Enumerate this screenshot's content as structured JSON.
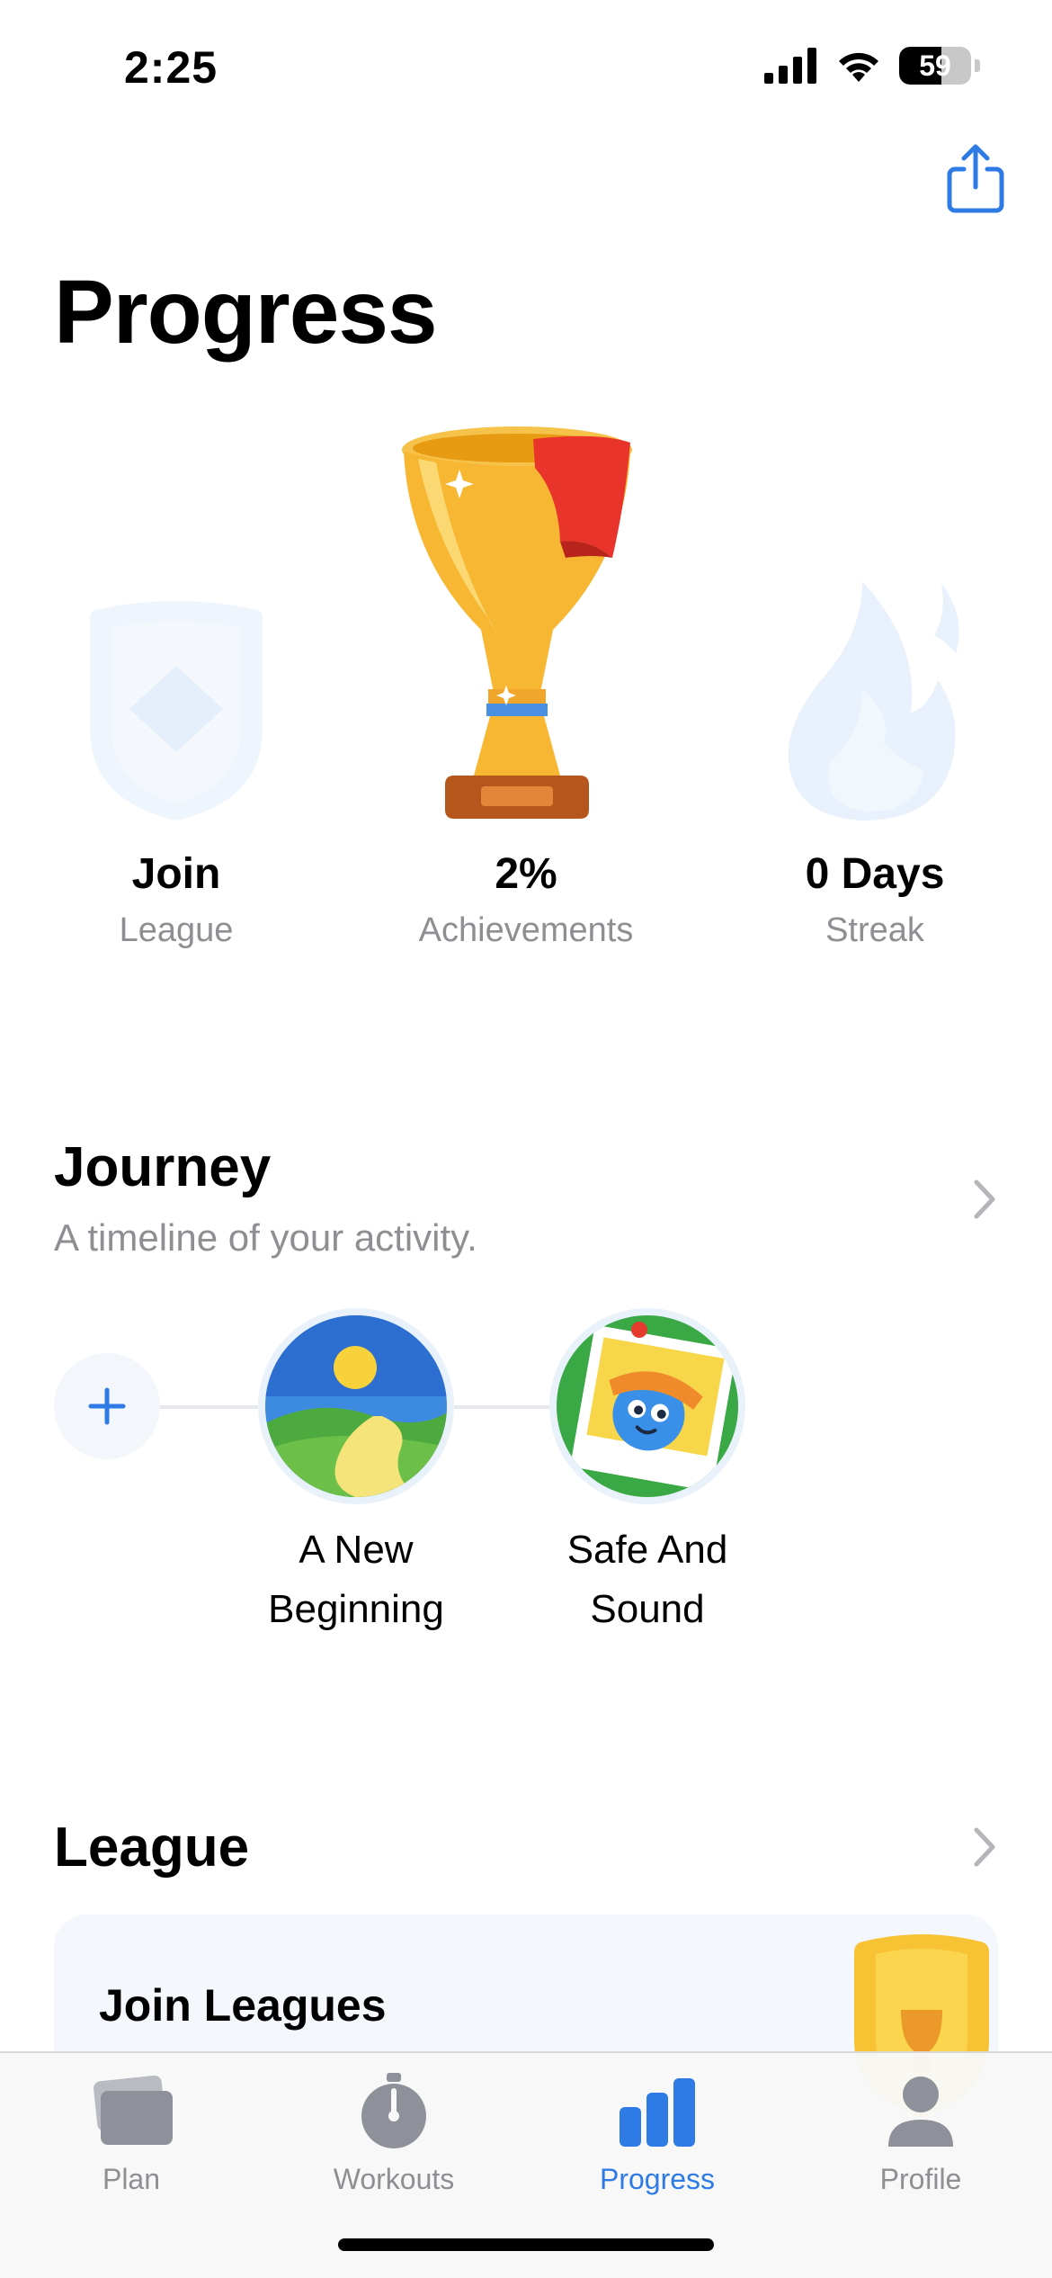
{
  "status_bar": {
    "time": "2:25",
    "battery": "59",
    "battery_level": 0.59
  },
  "page": {
    "title": "Progress"
  },
  "stats": [
    {
      "value": "Join",
      "label": "League",
      "icon": "shield-icon"
    },
    {
      "value": "2%",
      "label": "Achievements",
      "icon": "trophy-icon"
    },
    {
      "value": "0 Days",
      "label": "Streak",
      "icon": "flame-icon"
    }
  ],
  "journey": {
    "title": "Journey",
    "subtitle": "A timeline of your activity.",
    "items": [
      {
        "label_line1": "A New",
        "label_line2": "Beginning",
        "icon": "landscape-sun-icon"
      },
      {
        "label_line1": "Safe And",
        "label_line2": "Sound",
        "icon": "pinned-photo-icon"
      }
    ]
  },
  "league": {
    "title": "League",
    "card_title": "Join Leagues"
  },
  "tabs": [
    {
      "label": "Plan",
      "icon": "cards-icon",
      "active": false
    },
    {
      "label": "Workouts",
      "icon": "stopwatch-icon",
      "active": false
    },
    {
      "label": "Progress",
      "icon": "bar-chart-icon",
      "active": true
    },
    {
      "label": "Profile",
      "icon": "person-icon",
      "active": false
    }
  ],
  "colors": {
    "accent": "#2f7be6",
    "secondary_text": "#8e8e93",
    "trophy_gold": "#f7b733",
    "ribbon_red": "#e8342a"
  }
}
